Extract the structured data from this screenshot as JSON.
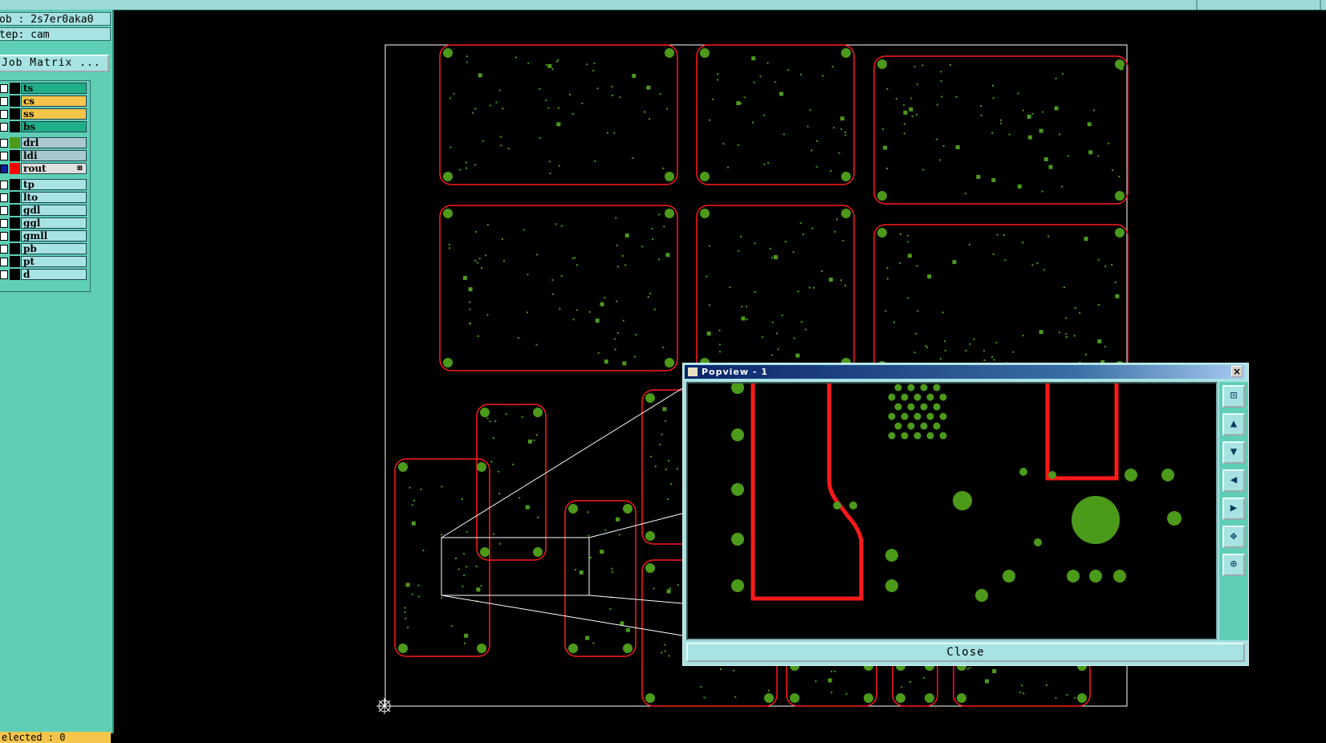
{
  "job": {
    "name_line": "ob : 2s7er0aka0",
    "step_line": "tep: cam"
  },
  "buttons": {
    "job_matrix": "Job Matrix ..."
  },
  "layers": [
    {
      "name": "ts",
      "color": "#000000",
      "bg": "#1fb08a"
    },
    {
      "name": "cs",
      "color": "#000000",
      "bg": "#f5c54b"
    },
    {
      "name": "ss",
      "color": "#000000",
      "bg": "#f5c54b"
    },
    {
      "name": "bs",
      "color": "#000000",
      "bg": "#1fb08a"
    },
    {
      "name": "drl",
      "color": "#4c9a1a",
      "bg": "#a9c9cf"
    },
    {
      "name": "ldi",
      "color": "#000000",
      "bg": "#a9c9cf"
    },
    {
      "name": "rout",
      "color": "#ff0000",
      "bg": "#e0e0e0",
      "mark": "⊞",
      "checkbox": "#0a1f9a"
    },
    {
      "name": "tp",
      "color": "#000000",
      "bg": "#a7e3e2"
    },
    {
      "name": "lto",
      "color": "#000000",
      "bg": "#a7e3e2"
    },
    {
      "name": "gdl",
      "color": "#000000",
      "bg": "#a7e3e2"
    },
    {
      "name": "ggl",
      "color": "#000000",
      "bg": "#a7e3e2"
    },
    {
      "name": "gmll",
      "color": "#000000",
      "bg": "#a7e3e2"
    },
    {
      "name": "pb",
      "color": "#000000",
      "bg": "#a7e3e2"
    },
    {
      "name": "pt",
      "color": "#000000",
      "bg": "#a7e3e2"
    },
    {
      "name": "d",
      "color": "#000000",
      "bg": "#a7e3e2"
    }
  ],
  "status": {
    "selected": "elected : 0"
  },
  "popup": {
    "title": "Popview - 1",
    "close_label": "Close",
    "tools": [
      "zoom-window-icon",
      "pan-up-icon",
      "pan-down-icon",
      "pan-left-icon",
      "pan-right-icon",
      "zoom-fit-icon",
      "zoom-center-icon"
    ]
  },
  "colors": {
    "pad": "#4c9a1a",
    "outline": "#ff1a1a",
    "panel": "#5ecfb5",
    "button": "#a7e3e2"
  }
}
